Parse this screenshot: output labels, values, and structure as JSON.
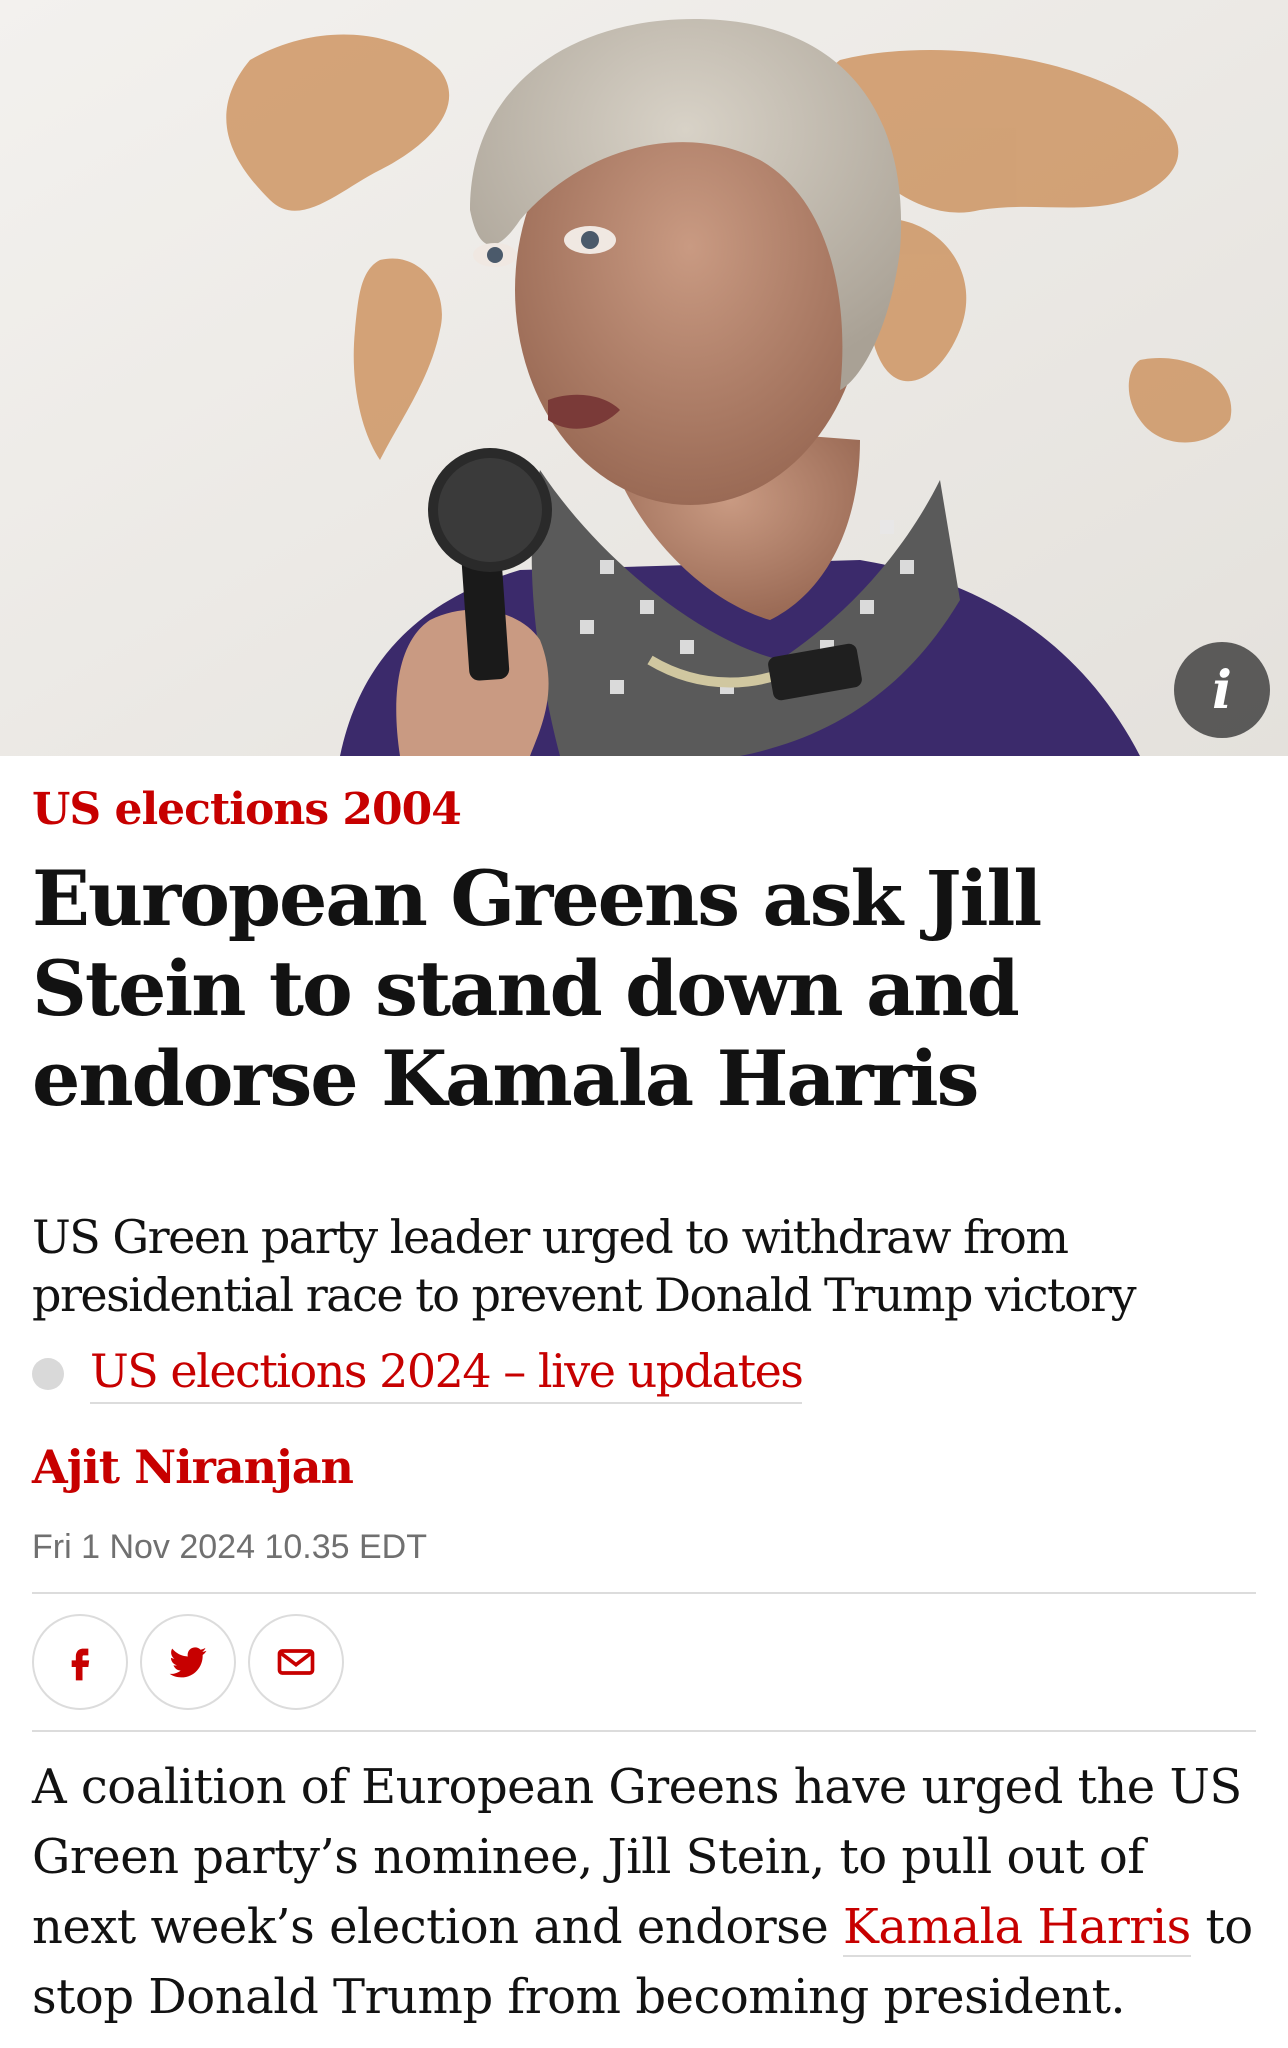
{
  "hero": {
    "image_alt": "Jill Stein speaking into a microphone in front of a world map",
    "info_icon": "info-icon",
    "info_label": "i"
  },
  "article": {
    "kicker": "US elections 2004",
    "headline": "European Greens ask Jill Stein to stand down and endorse Kamala Harris",
    "standfirst": "US Green party leader urged to withdraw from presidential race to prevent Donald Trump victory",
    "live_link": "US elections 2024 – live updates",
    "byline": "Ajit Niranjan",
    "dateline": "Fri 1 Nov 2024 10.35 EDT",
    "body_before_link": "A coalition of European Greens have urged the US Green party’s nominee, Jill Stein, to pull out of next week’s election and endorse ",
    "body_link": "Kamala Harris",
    "body_after_link": " to stop Donald Trump from becoming president."
  },
  "share": {
    "facebook_icon": "facebook-icon",
    "twitter_icon": "twitter-icon",
    "email_icon": "email-icon"
  },
  "colors": {
    "accent": "#c70000",
    "text": "#121212",
    "muted": "#707070",
    "rule": "#dcdcdc"
  }
}
